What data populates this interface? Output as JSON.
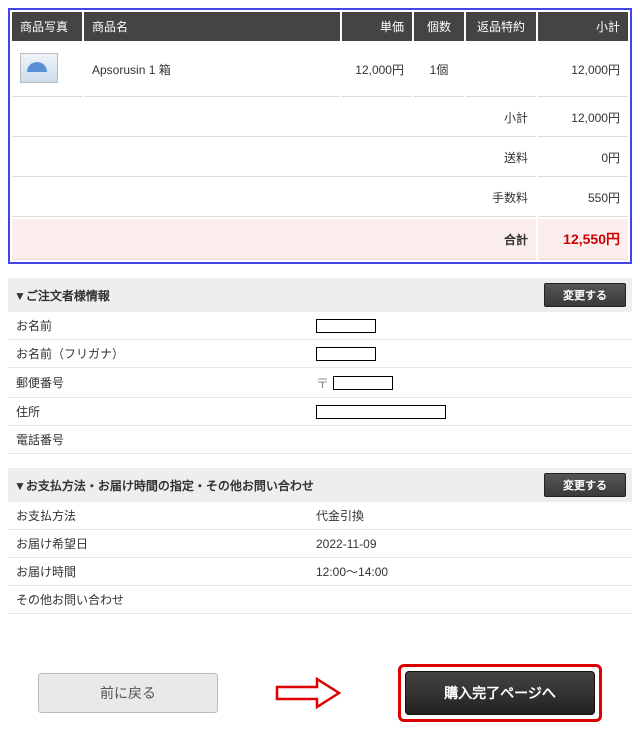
{
  "columns": {
    "photo": "商品写真",
    "name": "商品名",
    "price": "単価",
    "qty": "個数",
    "return": "返品特約",
    "subtotal": "小計"
  },
  "item": {
    "name": "Apsorusin 1 箱",
    "price": "12,000円",
    "qty": "1個",
    "return": "",
    "subtotal": "12,000円"
  },
  "summary": {
    "subtotal_label": "小計",
    "subtotal_value": "12,000円",
    "shipping_label": "送料",
    "shipping_value": "0円",
    "fee_label": "手数料",
    "fee_value": "550円",
    "total_label": "合計",
    "total_value": "12,550円"
  },
  "orderer": {
    "heading": "▼ご注文者様情報",
    "change": "変更する",
    "rows": {
      "name": "お名前",
      "kana": "お名前（フリガナ）",
      "postal": "郵便番号",
      "address": "住所",
      "phone": "電話番号"
    }
  },
  "payment": {
    "heading": "▼お支払方法・お届け時間の指定・その他お問い合わせ",
    "change": "変更する",
    "rows": {
      "method_label": "お支払方法",
      "method_value": "代金引換",
      "date_label": "お届け希望日",
      "date_value": "2022-11-09",
      "time_label": "お届け時間",
      "time_value": "12:00～14:00",
      "inquiry_label": "その他お問い合わせ",
      "inquiry_value": ""
    }
  },
  "buttons": {
    "back": "前に戻る",
    "complete": "購入完了ページへ"
  }
}
